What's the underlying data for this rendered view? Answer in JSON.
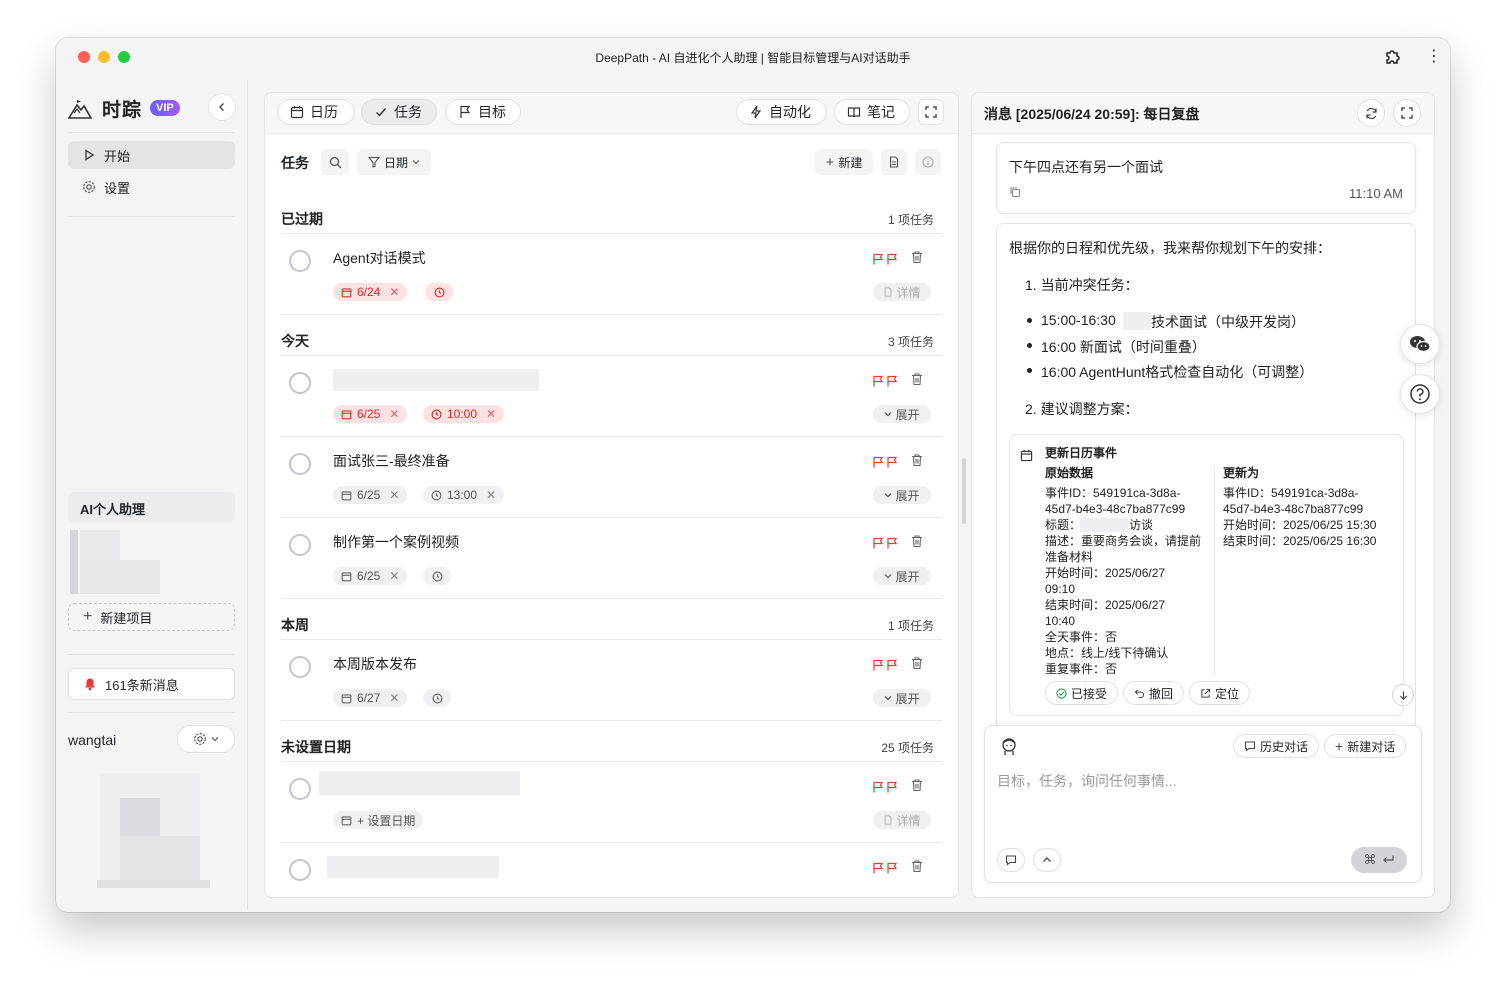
{
  "window": {
    "title": "DeepPath - AI 自进化个人助理 | 智能目标管理与AI对话助手"
  },
  "sidebar": {
    "brand": "时踪",
    "vip": "VIP",
    "nav": [
      {
        "label": "开始",
        "icon": "play-icon"
      },
      {
        "label": "设置",
        "icon": "gear-icon"
      }
    ],
    "ai_section": "AI个人助理",
    "new_project": "新建项目",
    "messages": "161条新消息",
    "user": "wangtai"
  },
  "toolbar": {
    "tabs": [
      {
        "label": "日历",
        "icon": "calendar-icon"
      },
      {
        "label": "任务",
        "icon": "check-icon"
      },
      {
        "label": "目标",
        "icon": "flag-icon"
      }
    ],
    "right": [
      {
        "label": "自动化",
        "icon": "bolt-icon"
      },
      {
        "label": "笔记",
        "icon": "book-icon"
      }
    ]
  },
  "tasks": {
    "title": "任务",
    "date_filter": "日期",
    "new": "新建",
    "sections": [
      {
        "title": "已过期",
        "count": "1 项任务",
        "items": [
          {
            "title": "Agent对话模式",
            "date": "6/24",
            "time": "",
            "action": "详情"
          }
        ]
      },
      {
        "title": "今天",
        "count": "3 项任务",
        "items": [
          {
            "title": "",
            "date": "6/25",
            "time": "10:00",
            "action": "展开"
          },
          {
            "title": "面试张三-最终准备",
            "date": "6/25",
            "time": "13:00",
            "action": "展开"
          },
          {
            "title": "制作第一个案例视频",
            "date": "6/25",
            "time": "",
            "action": "展开"
          }
        ]
      },
      {
        "title": "本周",
        "count": "1 项任务",
        "items": [
          {
            "title": "本周版本发布",
            "date": "6/27",
            "time": "",
            "action": "展开"
          }
        ]
      },
      {
        "title": "未设置日期",
        "count": "25 项任务",
        "items": [
          {
            "title": "",
            "date": "+ 设置日期",
            "time": "",
            "action": "详情"
          }
        ]
      }
    ]
  },
  "chat": {
    "header": "消息 [2025/06/24 20:59]: 每日复盘",
    "user_msg": "下午四点还有另一个面试",
    "user_time": "11:10 AM",
    "reply_intro": "根据你的日程和优先级，我来帮你规划下午的安排：",
    "step1": "1. 当前冲突任务：",
    "bullets": [
      {
        "time": "15:00-16:30",
        "text": "技术面试（中级开发岗）"
      },
      {
        "time": "",
        "text": "16:00 新面试（时间重叠）"
      },
      {
        "time": "",
        "text": "16:00 AgentHunt格式检查自动化（可调整）"
      }
    ],
    "step2": "2. 建议调整方案：",
    "card": {
      "title": "更新日历事件",
      "orig_label": "原始数据",
      "new_label": "更新为",
      "orig_lines": [
        "事件ID：549191ca-3d8a-",
        "45d7-b4e3-48c7ba877c99",
        "标题：",
        "描述：重要商务会谈，请提前",
        "准备材料",
        "开始时间：2025/06/27",
        "09:10",
        "结束时间：2025/06/27",
        "10:40",
        "全天事件：否",
        "地点：线上/线下待确认",
        "重复事件：否"
      ],
      "title_suffix": "访谈",
      "new_lines": [
        "事件ID：549191ca-3d8a-",
        "45d7-b4e3-48c7ba877c99",
        "开始时间：2025/06/25 15:30",
        "结束时间：2025/06/25 16:30"
      ],
      "actions": [
        "已接受",
        "撤回",
        "定位"
      ]
    },
    "history": "历史对话",
    "new_chat": "新建对话",
    "placeholder": "目标，任务，询问任何事情...",
    "send_key": "⌘"
  }
}
